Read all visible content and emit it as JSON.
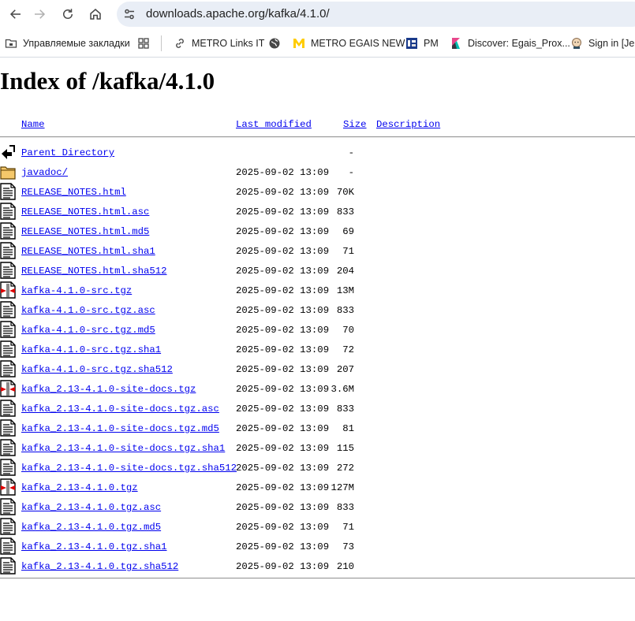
{
  "browser": {
    "url": "downloads.apache.org/kafka/4.1.0/",
    "bookmarks": [
      {
        "label": "Управляемые закладки",
        "icon": "folder-icon"
      },
      {
        "label": "",
        "icon": "apps-grid-icon"
      },
      {
        "label": "METRO Links IT",
        "icon": "link-icon"
      },
      {
        "label": "",
        "icon": "globe-icon"
      },
      {
        "label": "METRO EGAIS NEW",
        "icon": "metro-m-icon"
      },
      {
        "label": "PM",
        "icon": "pm-icon"
      },
      {
        "label": "Discover: Egais_Prox...",
        "icon": "kibana-icon"
      },
      {
        "label": "Sign in [Jen",
        "icon": "jenkins-icon"
      }
    ]
  },
  "page": {
    "title": "Index of /kafka/4.1.0",
    "columns": {
      "name": "Name",
      "last_modified": "Last modified",
      "size": "Size",
      "description": "Description"
    },
    "parent": {
      "name": "Parent Directory",
      "date": "",
      "size": "-",
      "icon": "back-arrow-icon"
    },
    "entries": [
      {
        "name": "javadoc/",
        "date": "2025-09-02 13:09",
        "size": "-",
        "icon": "folder-icon"
      },
      {
        "name": "RELEASE_NOTES.html",
        "date": "2025-09-02 13:09",
        "size": "70K",
        "icon": "text-file-icon"
      },
      {
        "name": "RELEASE_NOTES.html.asc",
        "date": "2025-09-02 13:09",
        "size": "833",
        "icon": "text-file-icon"
      },
      {
        "name": "RELEASE_NOTES.html.md5",
        "date": "2025-09-02 13:09",
        "size": "69",
        "icon": "text-file-icon"
      },
      {
        "name": "RELEASE_NOTES.html.sha1",
        "date": "2025-09-02 13:09",
        "size": "71",
        "icon": "text-file-icon"
      },
      {
        "name": "RELEASE_NOTES.html.sha512",
        "date": "2025-09-02 13:09",
        "size": "204",
        "icon": "text-file-icon"
      },
      {
        "name": "kafka-4.1.0-src.tgz",
        "date": "2025-09-02 13:09",
        "size": "13M",
        "icon": "compressed-file-icon"
      },
      {
        "name": "kafka-4.1.0-src.tgz.asc",
        "date": "2025-09-02 13:09",
        "size": "833",
        "icon": "text-file-icon"
      },
      {
        "name": "kafka-4.1.0-src.tgz.md5",
        "date": "2025-09-02 13:09",
        "size": "70",
        "icon": "text-file-icon"
      },
      {
        "name": "kafka-4.1.0-src.tgz.sha1",
        "date": "2025-09-02 13:09",
        "size": "72",
        "icon": "text-file-icon"
      },
      {
        "name": "kafka-4.1.0-src.tgz.sha512",
        "date": "2025-09-02 13:09",
        "size": "207",
        "icon": "text-file-icon"
      },
      {
        "name": "kafka_2.13-4.1.0-site-docs.tgz",
        "date": "2025-09-02 13:09",
        "size": "3.6M",
        "icon": "compressed-file-icon"
      },
      {
        "name": "kafka_2.13-4.1.0-site-docs.tgz.asc",
        "date": "2025-09-02 13:09",
        "size": "833",
        "icon": "text-file-icon"
      },
      {
        "name": "kafka_2.13-4.1.0-site-docs.tgz.md5",
        "date": "2025-09-02 13:09",
        "size": "81",
        "icon": "text-file-icon"
      },
      {
        "name": "kafka_2.13-4.1.0-site-docs.tgz.sha1",
        "date": "2025-09-02 13:09",
        "size": "115",
        "icon": "text-file-icon"
      },
      {
        "name": "kafka_2.13-4.1.0-site-docs.tgz.sha512",
        "date": "2025-09-02 13:09",
        "size": "272",
        "icon": "text-file-icon"
      },
      {
        "name": "kafka_2.13-4.1.0.tgz",
        "date": "2025-09-02 13:09",
        "size": "127M",
        "icon": "compressed-file-icon"
      },
      {
        "name": "kafka_2.13-4.1.0.tgz.asc",
        "date": "2025-09-02 13:09",
        "size": "833",
        "icon": "text-file-icon"
      },
      {
        "name": "kafka_2.13-4.1.0.tgz.md5",
        "date": "2025-09-02 13:09",
        "size": "71",
        "icon": "text-file-icon"
      },
      {
        "name": "kafka_2.13-4.1.0.tgz.sha1",
        "date": "2025-09-02 13:09",
        "size": "73",
        "icon": "text-file-icon"
      },
      {
        "name": "kafka_2.13-4.1.0.tgz.sha512",
        "date": "2025-09-02 13:09",
        "size": "210",
        "icon": "text-file-icon"
      }
    ]
  }
}
